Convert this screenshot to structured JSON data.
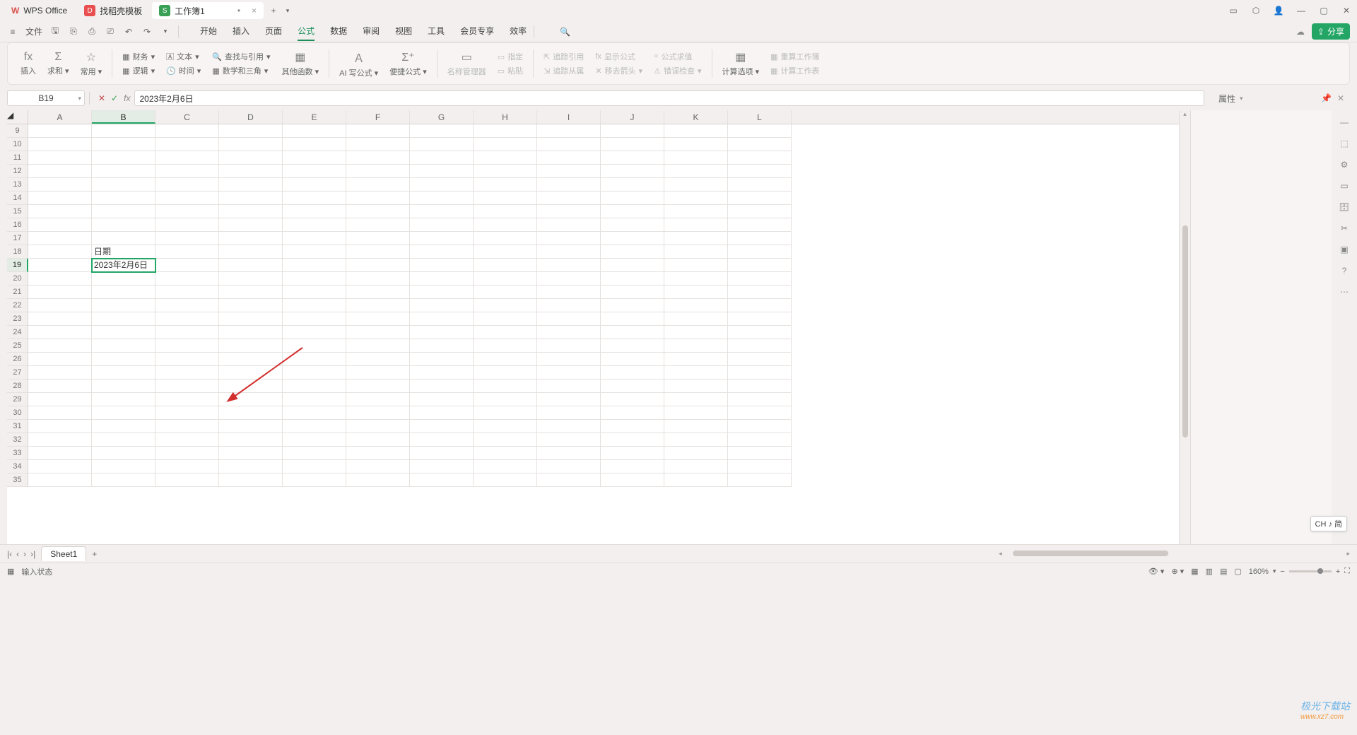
{
  "titlebar": {
    "app": "WPS Office",
    "tab_template": "找稻壳模板",
    "tab_template_icon": "D",
    "doc_icon": "S",
    "doc_name": "工作簿1",
    "dirty": "•",
    "newtab_glyph": "+",
    "newtab_dd": "▾"
  },
  "menubar": {
    "file": "文件",
    "tabs": [
      "开始",
      "插入",
      "页面",
      "公式",
      "数据",
      "审阅",
      "视图",
      "工具",
      "会员专享",
      "效率"
    ],
    "active": "公式",
    "share": "分享"
  },
  "ribbon": {
    "g1": {
      "insert": "插入",
      "sum": "求和",
      "common": "常用"
    },
    "g2": {
      "finance": "财务",
      "text": "文本",
      "lookup": "查找与引用",
      "logic": "逻辑",
      "time": "时间",
      "math": "数学和三角",
      "other": "其他函数"
    },
    "g3": {
      "ai": "AI 写公式",
      "quick": "便捷公式"
    },
    "g4": {
      "name": "名称管理器",
      "define": "指定",
      "paste": "粘贴"
    },
    "g5": {
      "trace": "追踪引用",
      "show": "显示公式",
      "dep": "追踪从属",
      "remove": "移去箭头",
      "eval": "公式求值",
      "check": "错误检查"
    },
    "g6": {
      "calcopt": "计算选项",
      "recalc": "重算工作簿",
      "calcsheet": "计算工作表"
    }
  },
  "namebox": {
    "cell": "B19"
  },
  "formula": {
    "value": "2023年2月6日"
  },
  "prop": {
    "title": "属性"
  },
  "grid": {
    "cols": [
      "A",
      "B",
      "C",
      "D",
      "E",
      "F",
      "G",
      "H",
      "I",
      "J",
      "K",
      "L"
    ],
    "sel_col": "B",
    "rows": [
      9,
      10,
      11,
      12,
      13,
      14,
      15,
      16,
      17,
      18,
      19,
      20,
      21,
      22,
      23,
      24,
      25,
      26,
      27,
      28,
      29,
      30,
      31,
      32,
      33,
      34,
      35
    ],
    "sel_row": 19,
    "b18": "日期",
    "b19": "2023年2月6日"
  },
  "sheet": {
    "name": "Sheet1",
    "add": "+"
  },
  "status": {
    "mode": "输入状态",
    "zoom": "160%"
  },
  "ime": "CH ♪ 简",
  "wm": {
    "brand": "极光下载站",
    "url": "www.xz7.com"
  }
}
